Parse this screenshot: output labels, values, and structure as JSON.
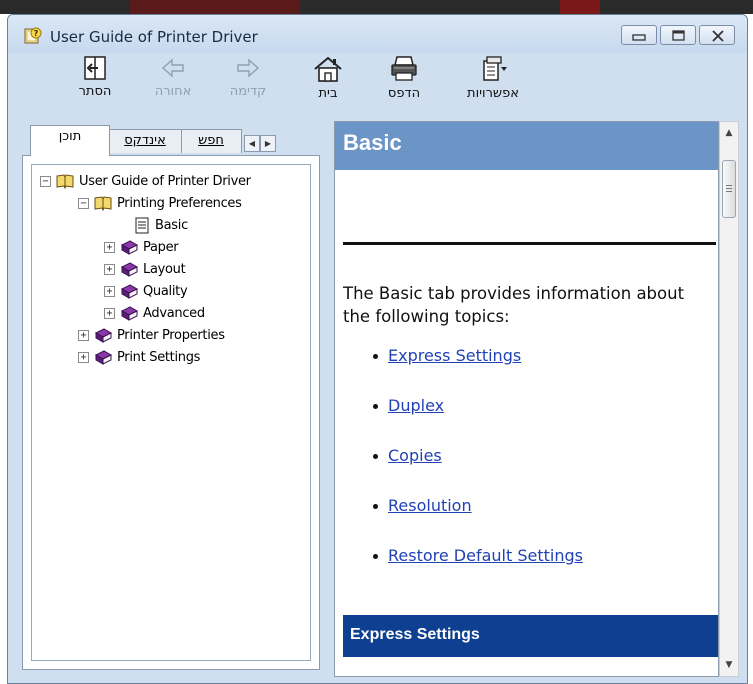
{
  "window": {
    "title": "User Guide of Printer Driver",
    "buttons": [
      "minimize",
      "maximize",
      "close"
    ]
  },
  "toolbar": {
    "items": [
      {
        "label": "הסתר",
        "icon": "hide-icon",
        "enabled": true
      },
      {
        "label": "אחורה",
        "icon": "back-arrow-icon",
        "enabled": false
      },
      {
        "label": "קדימה",
        "icon": "forward-arrow-icon",
        "enabled": false
      },
      {
        "label": "בית",
        "icon": "home-icon",
        "enabled": true
      },
      {
        "label": "הדפס",
        "icon": "print-icon",
        "enabled": true
      },
      {
        "label": "אפשרויות",
        "icon": "options-icon",
        "enabled": true
      }
    ]
  },
  "tabs": {
    "contents": "תוכן",
    "index": "אינדקס",
    "search": "חפש",
    "active": "contents"
  },
  "tree": {
    "root": "User Guide of Printer Driver",
    "printing_preferences": "Printing Preferences",
    "basic": "Basic",
    "paper": "Paper",
    "layout": "Layout",
    "quality": "Quality",
    "advanced": "Advanced",
    "printer_properties": "Printer Properties",
    "print_settings": "Print Settings",
    "selected": "Basic"
  },
  "content": {
    "heading": "Basic",
    "intro": "The Basic tab provides information about the following topics:",
    "links": [
      "Express Settings",
      "Duplex",
      "Copies",
      "Resolution",
      "Restore Default Settings"
    ],
    "section_heading": "Express Settings"
  },
  "colors": {
    "header_bg": "#6a95c6",
    "section_bg": "#0e3f90",
    "link": "#2142b5",
    "chrome": "#cfdff0"
  }
}
